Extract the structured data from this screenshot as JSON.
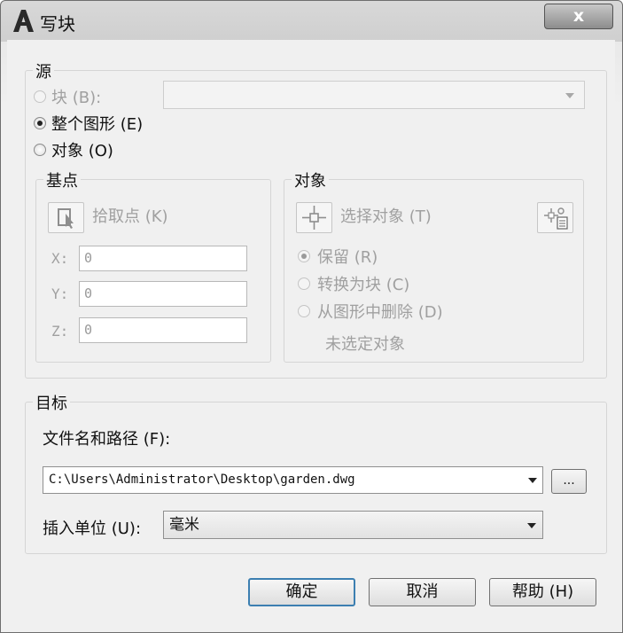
{
  "window": {
    "title": "写块",
    "close_glyph": "x"
  },
  "source": {
    "group_label": "源",
    "block_radio_label": "块 (B):",
    "whole_drawing_radio_label": "整个图形 (E)",
    "objects_radio_label": "对象 (O)",
    "selected": "whole_drawing",
    "block_combo_value": ""
  },
  "base_point": {
    "group_label": "基点",
    "pick_point_label": "拾取点 (K)",
    "x_label": "X:",
    "x_value": "0",
    "y_label": "Y:",
    "y_value": "0",
    "z_label": "Z:",
    "z_value": "0"
  },
  "objects": {
    "group_label": "对象",
    "select_objects_label": "选择对象 (T)",
    "retain_label": "保留 (R)",
    "convert_to_block_label": "转换为块 (C)",
    "delete_label": "从图形中删除 (D)",
    "status_text": "未选定对象",
    "selected": "retain"
  },
  "destination": {
    "group_label": "目标",
    "file_path_label": "文件名和路径 (F):",
    "file_path_value": "C:\\Users\\Administrator\\Desktop\\garden.dwg",
    "browse_label": "...",
    "insert_units_label": "插入单位 (U):",
    "insert_units_value": "毫米"
  },
  "buttons": {
    "ok": "确定",
    "cancel": "取消",
    "help": "帮助 (H)"
  },
  "icons": {
    "app": "autocad-a-icon",
    "pick_point": "pick-point-icon",
    "select_objects": "select-objects-icon",
    "quick_select": "quick-select-icon"
  }
}
